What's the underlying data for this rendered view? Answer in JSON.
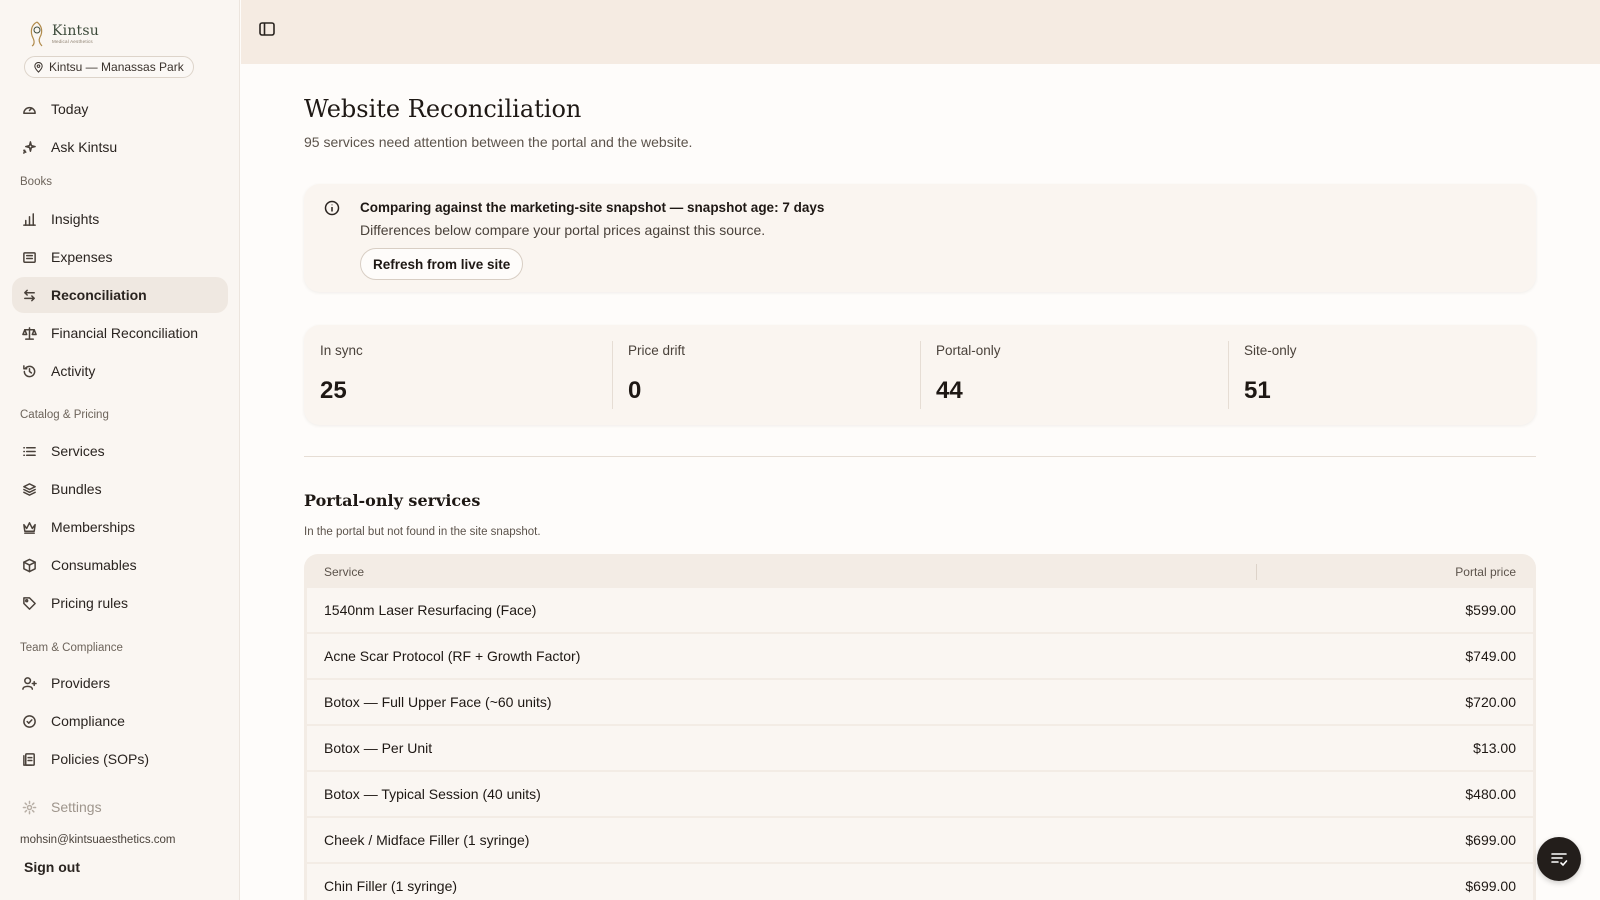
{
  "brand": {
    "name": "Kintsu",
    "sub": "Medical Aesthetics",
    "location": "Kintsu — Manassas Park"
  },
  "sidebar": {
    "top_items": [
      {
        "label": "Today",
        "icon": "gauge-icon"
      },
      {
        "label": "Ask Kintsu",
        "icon": "sparkle-icon"
      }
    ],
    "sections": [
      {
        "label": "Books"
      },
      {
        "label": "Catalog & Pricing"
      },
      {
        "label": "Team & Compliance"
      }
    ],
    "books_items": [
      {
        "label": "Insights",
        "icon": "bar-chart-icon"
      },
      {
        "label": "Expenses",
        "icon": "receipt-icon"
      },
      {
        "label": "Reconciliation",
        "icon": "arrows-swap-icon",
        "active": true
      },
      {
        "label": "Financial Reconciliation",
        "icon": "scale-icon"
      },
      {
        "label": "Activity",
        "icon": "history-icon"
      }
    ],
    "catalog_items": [
      {
        "label": "Services",
        "icon": "list-icon"
      },
      {
        "label": "Bundles",
        "icon": "layers-icon"
      },
      {
        "label": "Memberships",
        "icon": "crown-icon"
      },
      {
        "label": "Consumables",
        "icon": "box-icon"
      },
      {
        "label": "Pricing rules",
        "icon": "tag-icon"
      }
    ],
    "team_items": [
      {
        "label": "Providers",
        "icon": "user-plus-icon"
      },
      {
        "label": "Compliance",
        "icon": "badge-check-icon"
      },
      {
        "label": "Policies (SOPs)",
        "icon": "documents-icon"
      }
    ],
    "settings": {
      "label": "Settings",
      "icon": "gear-icon"
    },
    "user_email": "mohsin@kintsuaesthetics.com",
    "sign_out": "Sign out"
  },
  "main": {
    "title": "Website Reconciliation",
    "subtitle": "95 services need attention between the portal and the website.",
    "snapshot": {
      "title": "Comparing against the marketing-site snapshot — snapshot age: 7 days",
      "description": "Differences below compare your portal prices against this source.",
      "refresh_label": "Refresh from live site"
    },
    "stats": [
      {
        "label": "In sync",
        "value": "25"
      },
      {
        "label": "Price drift",
        "value": "0"
      },
      {
        "label": "Portal-only",
        "value": "44"
      },
      {
        "label": "Site-only",
        "value": "51"
      }
    ],
    "portal_only": {
      "title": "Portal-only services",
      "subtitle": "In the portal but not found in the site snapshot.",
      "columns": {
        "service": "Service",
        "price": "Portal price"
      },
      "rows": [
        {
          "service": "1540nm Laser Resurfacing (Face)",
          "price": "$599.00"
        },
        {
          "service": "Acne Scar Protocol (RF + Growth Factor)",
          "price": "$749.00"
        },
        {
          "service": "Botox — Full Upper Face (~60 units)",
          "price": "$720.00"
        },
        {
          "service": "Botox — Per Unit",
          "price": "$13.00"
        },
        {
          "service": "Botox — Typical Session (40 units)",
          "price": "$480.00"
        },
        {
          "service": "Cheek / Midface Filler (1 syringe)",
          "price": "$699.00"
        },
        {
          "service": "Chin Filler (1 syringe)",
          "price": "$699.00"
        }
      ]
    }
  }
}
